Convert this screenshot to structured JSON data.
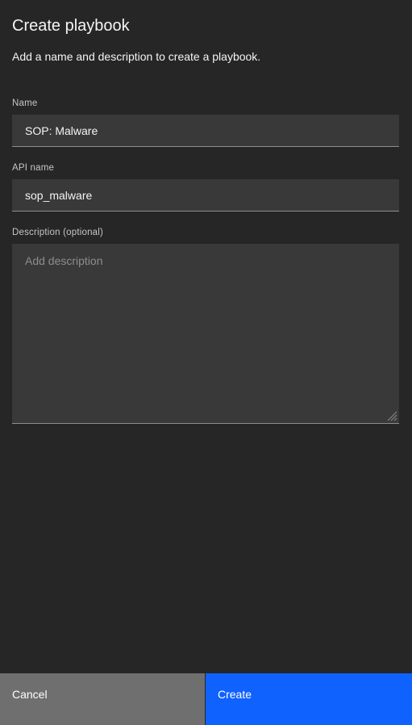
{
  "dialog": {
    "title": "Create playbook",
    "subtitle": "Add a name and description to create a playbook."
  },
  "form": {
    "name": {
      "label": "Name",
      "value": "SOP: Malware"
    },
    "api_name": {
      "label": "API name",
      "value": "sop_malware"
    },
    "description": {
      "label": "Description (optional)",
      "value": "",
      "placeholder": "Add description"
    }
  },
  "footer": {
    "cancel_label": "Cancel",
    "create_label": "Create"
  },
  "colors": {
    "background": "#262626",
    "field_background": "#393939",
    "cancel_button": "#6f6f6f",
    "primary_button": "#0f62fe"
  }
}
